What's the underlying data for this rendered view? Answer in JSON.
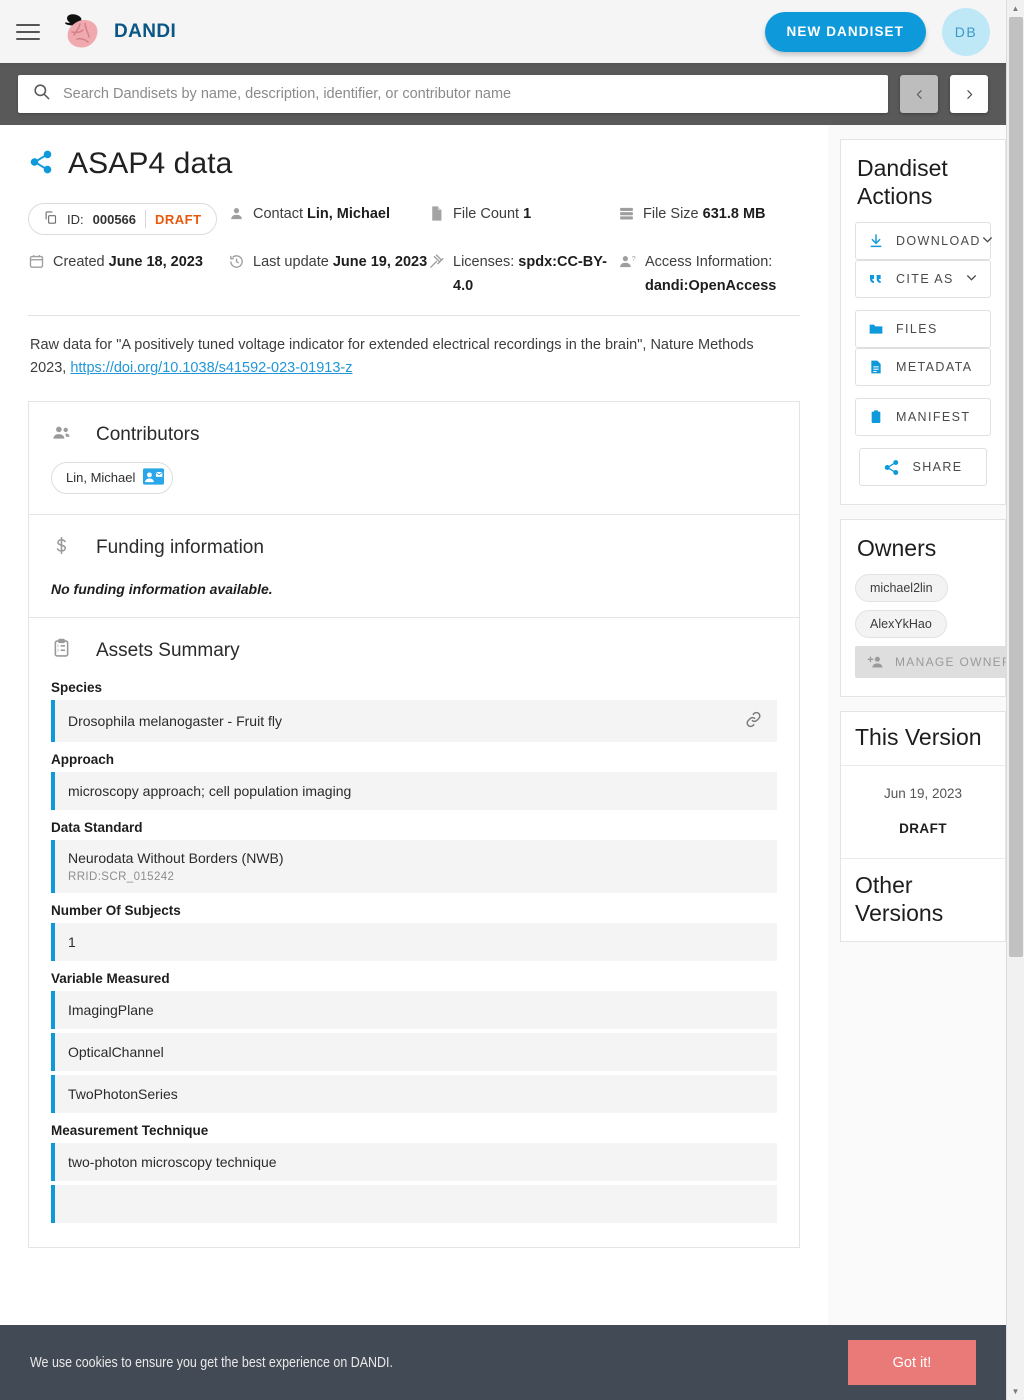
{
  "header": {
    "brand": "DANDI",
    "menu_icon": "hamburger-icon",
    "new_dandiset_label": "NEW DANDISET",
    "avatar_initials": "DB"
  },
  "search": {
    "placeholder": "Search Dandisets by name, description, identifier, or contributor name",
    "value": "",
    "prev_label": "‹",
    "next_label": "›"
  },
  "dandiset": {
    "title": "ASAP4 data",
    "id_label": "ID:",
    "id_value": "000566",
    "status": "DRAFT",
    "meta": [
      {
        "label": "Contact ",
        "value": "Lin, Michael",
        "icon": "person-icon"
      },
      {
        "label": "File Count ",
        "value": "1",
        "icon": "file-icon"
      },
      {
        "label": "File Size ",
        "value": "631.8 MB",
        "icon": "storage-icon"
      },
      {
        "label": "Created ",
        "value": "June 18, 2023",
        "icon": "calendar-icon"
      },
      {
        "label": "Last update ",
        "value": "June 19, 2023",
        "icon": "history-icon"
      },
      {
        "label": "Licenses: ",
        "value": "spdx:CC-BY-4.0",
        "icon": "gavel-icon"
      },
      {
        "label": "Access Information: ",
        "value": "dandi:OpenAccess",
        "icon": "person-question-icon"
      }
    ],
    "description_before": "Raw data for \"A positively tuned voltage indicator for extended electrical recordings in the brain\", Nature Methods 2023, ",
    "description_link": "https://doi.org/10.1038/s41592-023-01913-z"
  },
  "contributors": {
    "heading": "Contributors",
    "items": [
      {
        "name": "Lin, Michael",
        "badge": "contact-card-icon"
      }
    ]
  },
  "funding": {
    "heading": "Funding information",
    "empty_text": "No funding information available."
  },
  "assets_summary": {
    "heading": "Assets Summary",
    "groups": [
      {
        "label": "Species",
        "rows": [
          {
            "text": "Drosophila melanogaster - Fruit fly",
            "sub": "",
            "link": true
          }
        ]
      },
      {
        "label": "Approach",
        "rows": [
          {
            "text": "microscopy approach; cell population imaging",
            "sub": "",
            "link": false
          }
        ]
      },
      {
        "label": "Data Standard",
        "rows": [
          {
            "text": "Neurodata Without Borders (NWB)",
            "sub": "RRID:SCR_015242",
            "link": false
          }
        ]
      },
      {
        "label": "Number Of Subjects",
        "rows": [
          {
            "text": "1",
            "sub": "",
            "link": false
          }
        ]
      },
      {
        "label": "Variable Measured",
        "rows": [
          {
            "text": "ImagingPlane",
            "sub": "",
            "link": false
          },
          {
            "text": "OpticalChannel",
            "sub": "",
            "link": false
          },
          {
            "text": "TwoPhotonSeries",
            "sub": "",
            "link": false
          }
        ]
      },
      {
        "label": "Measurement Technique",
        "rows": [
          {
            "text": "two-photon microscopy technique",
            "sub": "",
            "link": false
          },
          {
            "text": "",
            "sub": "",
            "link": false
          }
        ]
      }
    ]
  },
  "actions_panel": {
    "title": "Dandiset Actions",
    "buttons": [
      {
        "label": "DOWNLOAD",
        "icon": "download-icon",
        "caret": true
      },
      {
        "label": "CITE AS",
        "icon": "quote-icon",
        "caret": true
      },
      {
        "label": "FILES",
        "icon": "folder-icon",
        "caret": false
      },
      {
        "label": "METADATA",
        "icon": "document-icon",
        "caret": false
      },
      {
        "label": "MANIFEST",
        "icon": "clipboard-icon",
        "caret": false
      }
    ],
    "share_label": "SHARE"
  },
  "owners_panel": {
    "title": "Owners",
    "owners": [
      "michael2lin",
      "AlexYkHao"
    ],
    "manage_label": "MANAGE OWNERS"
  },
  "version_panel": {
    "title": "This Version",
    "date": "Jun 19, 2023",
    "status": "DRAFT",
    "other_title": "Other Versions"
  },
  "cookie": {
    "text": "We use cookies to ensure you get the best experience on DANDI.",
    "button": "Got it!"
  },
  "colors": {
    "accent": "#0e9ada",
    "brand": "#0a5685",
    "draft": "#e8590c",
    "cookie_bg": "#424a55",
    "cookie_btn": "#ea7a77"
  }
}
